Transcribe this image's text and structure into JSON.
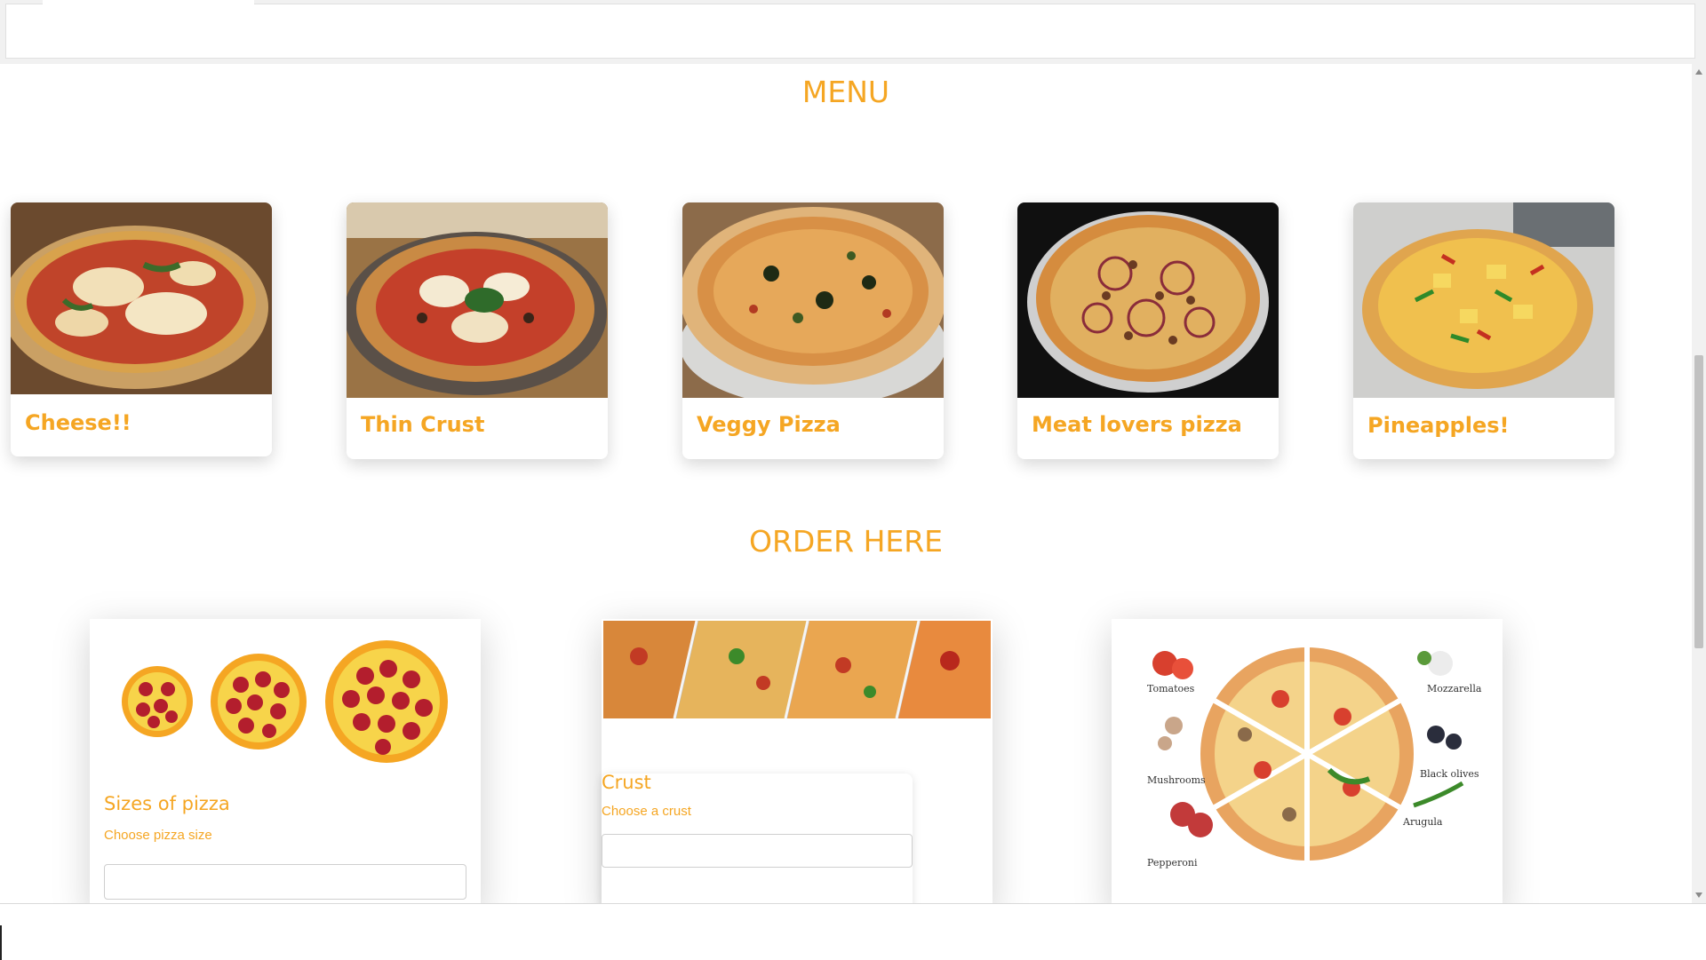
{
  "menu": {
    "title": "MENU",
    "items": [
      {
        "label": "Cheese!!"
      },
      {
        "label": "Thin Crust"
      },
      {
        "label": "Veggy Pizza"
      },
      {
        "label": "Meat lovers pizza"
      },
      {
        "label": "Pineapples!"
      }
    ]
  },
  "order": {
    "title": "ORDER HERE",
    "size": {
      "label": "Sizes of pizza",
      "hint": "Choose pizza size",
      "value": ""
    },
    "crust": {
      "label": "Crust",
      "hint": "Choose a crust",
      "value": ""
    },
    "toppings_image": {
      "captions": [
        "Tomatoes",
        "Mozzarella",
        "Mushrooms",
        "Black olives",
        "Arugula",
        "Pepperoni"
      ]
    }
  },
  "colors": {
    "accent": "#f5a623"
  }
}
